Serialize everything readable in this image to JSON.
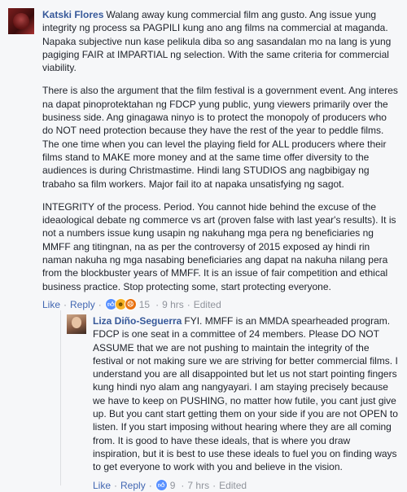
{
  "comments": [
    {
      "author": "Katski Flores",
      "paragraphs": [
        "Walang away kung commercial film ang gusto. Ang issue yung integrity ng process sa PAGPILI kung ano ang films na commercial at maganda. Napaka subjective nun kase pelikula diba so ang sasandalan mo na lang is yung pagiging FAIR at IMPARTIAL ng selection. With the same criteria for commercial viability.",
        "There is also the argument that the film festival is a government event. Ang interes na dapat pinoprotektahan ng FDCP yung public, yung viewers primarily over the business side. Ang ginagawa ninyo is to protect the monopoly of producers who do NOT need protection because they have the rest of the year to peddle films. The one time when you can level the playing field for ALL producers where their films stand to MAKE more money and at the same time offer diversity to the audiences is during Christmastime. Hindi lang STUDIOS ang nagbibigay ng trabaho sa film workers. Major fail ito at napaka unsatisfying ng sagot.",
        "INTEGRITY of the process. Period. You cannot hide behind the excuse of the ideaological debate ng commerce vs art (proven false with last year's results). It is not a numbers issue kung usapin ng nakuhang mga pera ng beneficiaries ng MMFF ang titingnan, na as per the controversy of 2015 exposed ay hindi rin naman nakuha ng mga nasabing beneficiaries ang dapat na nakuha nilang pera from the blockbuster years of MMFF. It is an issue of fair competition and ethical business practice. Stop protecting some, start protecting everyone."
      ],
      "actions": {
        "like": "Like",
        "reply": "Reply",
        "reaction_count": "15",
        "time": "9 hrs",
        "edited": "Edited"
      }
    },
    {
      "author": "Liza Diño-Seguerra",
      "paragraphs": [
        "FYI. MMFF is an MMDA spearheaded program. FDCP is one seat in a committee of 24 members. Please DO NOT ASSUME that we are not pushing to maintain the integrity of the festival or not making sure we are striving for better commercial films. I understand you are all disappointed but let us not start pointing fingers kung hindi nyo alam ang nangyayari. I am staying precisely because we have to keep on PUSHING, no matter how futile, you cant just give up. But you cant start getting them on your side if you are not OPEN to listen. If you start imposing without hearing where they are all coming from. It is good to have these ideals, that is where you draw inspiration, but it is best to use these ideals to fuel you on finding ways to get everyone to work with you and believe in the vision."
      ],
      "actions": {
        "like": "Like",
        "reply": "Reply",
        "reaction_count": "9",
        "time": "7 hrs",
        "edited": "Edited"
      }
    }
  ],
  "separator": "·",
  "colors": {
    "author": "#365899",
    "action_link": "#4267b2",
    "meta": "#90949c",
    "like_reaction": "#5890ff",
    "haha_reaction": "#f7b125",
    "angry_reaction": "#e9710f"
  }
}
